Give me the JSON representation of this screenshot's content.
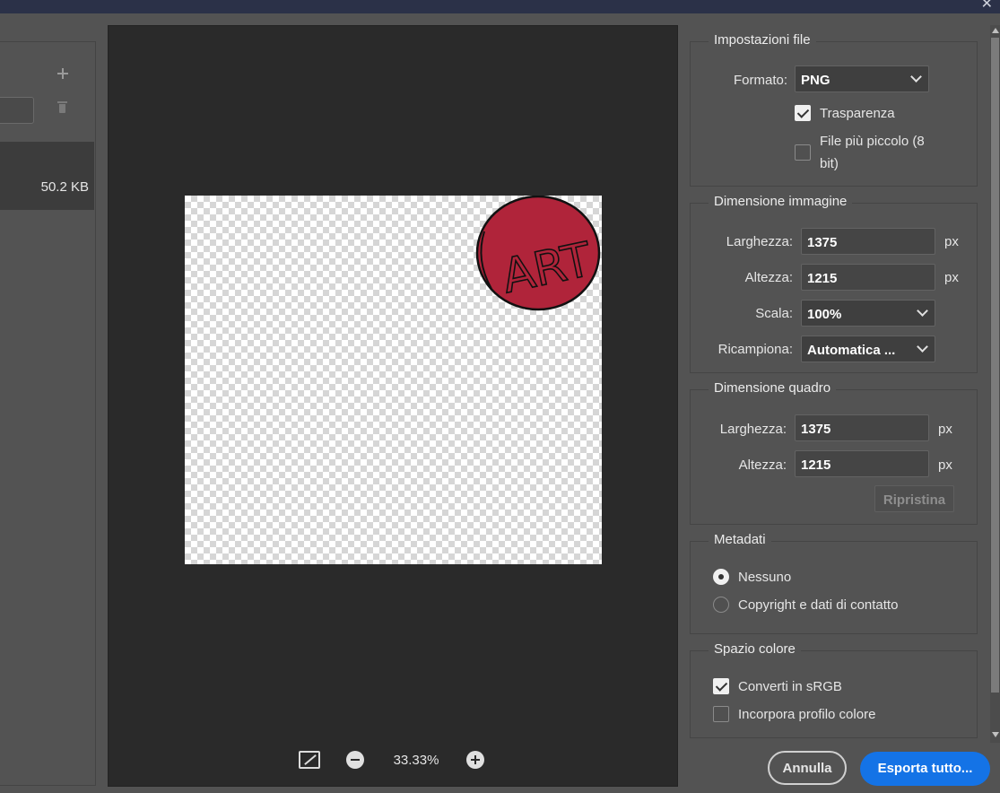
{
  "window": {
    "close_glyph": "✕"
  },
  "left_panel": {
    "file_size": "50.2 KB"
  },
  "preview": {
    "sticker_text": "ART",
    "sticker_color": "#b0243a",
    "zoom_value": "33.33%"
  },
  "file_settings": {
    "title": "Impostazioni file",
    "format_label": "Formato:",
    "format_value": "PNG",
    "transparency_label": "Trasparenza",
    "transparency_checked": true,
    "smaller_file_label_1": "File più piccolo (8",
    "smaller_file_label_2": "bit)",
    "smaller_file_checked": false
  },
  "image_size": {
    "title": "Dimensione immagine",
    "width_label": "Larghezza:",
    "width_value": "1375",
    "height_label": "Altezza:",
    "height_value": "1215",
    "unit": "px",
    "scale_label": "Scala:",
    "scale_value": "100%",
    "resample_label": "Ricampiona:",
    "resample_value": "Automatica ..."
  },
  "canvas_size": {
    "title": "Dimensione quadro",
    "width_label": "Larghezza:",
    "width_value": "1375",
    "height_label": "Altezza:",
    "height_value": "1215",
    "unit": "px",
    "reset_label": "Ripristina"
  },
  "metadata": {
    "title": "Metadati",
    "options": [
      "Nessuno",
      "Copyright e dati di contatto"
    ],
    "selected": "Nessuno"
  },
  "color_space": {
    "title": "Spazio colore",
    "convert_label": "Converti in sRGB",
    "convert_checked": true,
    "embed_label": "Incorpora profilo colore",
    "embed_checked": false
  },
  "footer": {
    "cancel_label": "Annulla",
    "export_label": "Esporta tutto..."
  },
  "colors": {
    "accent": "#1473e6",
    "panel_bg": "#535353",
    "preview_bg": "#2a2a2a"
  }
}
